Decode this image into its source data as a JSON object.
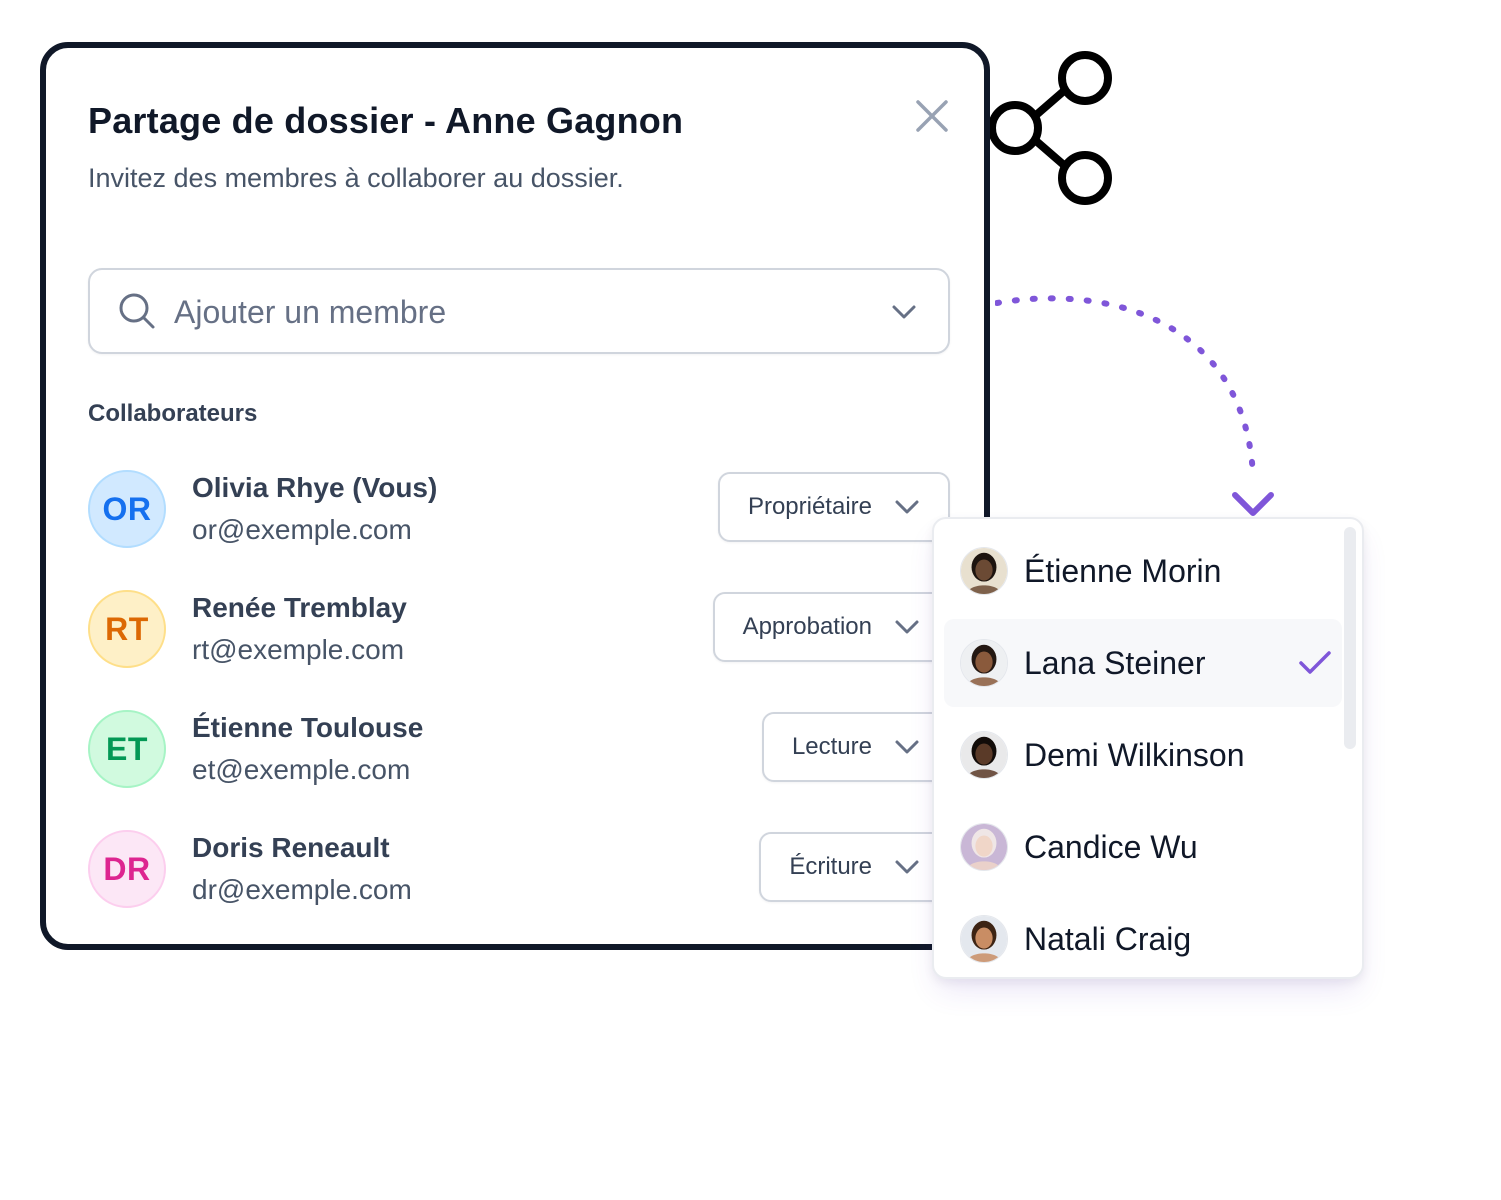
{
  "modal": {
    "title": "Partage de dossier - Anne Gagnon",
    "subtitle": "Invitez des membres à collaborer au dossier.",
    "close_icon": "close-icon"
  },
  "search": {
    "placeholder": "Ajouter un membre",
    "value": "",
    "icon": "search-icon",
    "dropdown_icon": "chevron-down-icon"
  },
  "collaborators": {
    "label": "Collaborateurs",
    "items": [
      {
        "initials": "OR",
        "name": "Olivia Rhye (Vous)",
        "email": "or@exemple.com",
        "role": "Propriétaire",
        "color": "#1570ef",
        "bg": "#d1e9ff",
        "border": "#b2ddff"
      },
      {
        "initials": "RT",
        "name": "Renée Tremblay",
        "email": "rt@exemple.com",
        "role": "Approbation",
        "color": "#dc6803",
        "bg": "#fef0c7",
        "border": "#fedf89"
      },
      {
        "initials": "ET",
        "name": "Étienne Toulouse",
        "email": "et@exemple.com",
        "role": "Lecture",
        "color": "#039855",
        "bg": "#d1fadf",
        "border": "#a6f4c5"
      },
      {
        "initials": "DR",
        "name": "Doris Reneault",
        "email": "dr@exemple.com",
        "role": "Écriture",
        "color": "#dd2590",
        "bg": "#fce7f6",
        "border": "#fcceee"
      }
    ]
  },
  "member_dropdown": {
    "items": [
      {
        "name": "Étienne Morin",
        "selected": false,
        "skin": "#6b4a34",
        "hair": "#1d140f",
        "bg": "#e8e0cf"
      },
      {
        "name": "Lana Steiner",
        "selected": true,
        "skin": "#8a5a3c",
        "hair": "#241812",
        "bg": "#eef0f2"
      },
      {
        "name": "Demi Wilkinson",
        "selected": false,
        "skin": "#5a3a28",
        "hair": "#120c09",
        "bg": "#e9e9ea"
      },
      {
        "name": "Candice Wu",
        "selected": false,
        "skin": "#f0d6c8",
        "hair": "#efe6e6",
        "bg": "#c9b7d6"
      },
      {
        "name": "Natali Craig",
        "selected": false,
        "skin": "#c98d64",
        "hair": "#3d2414",
        "bg": "#e4e8ee"
      }
    ],
    "check_icon": "check-icon"
  },
  "colors": {
    "accent": "#7f56d9",
    "border_dark": "#101828",
    "text_primary": "#101828",
    "text_secondary": "#475467"
  }
}
